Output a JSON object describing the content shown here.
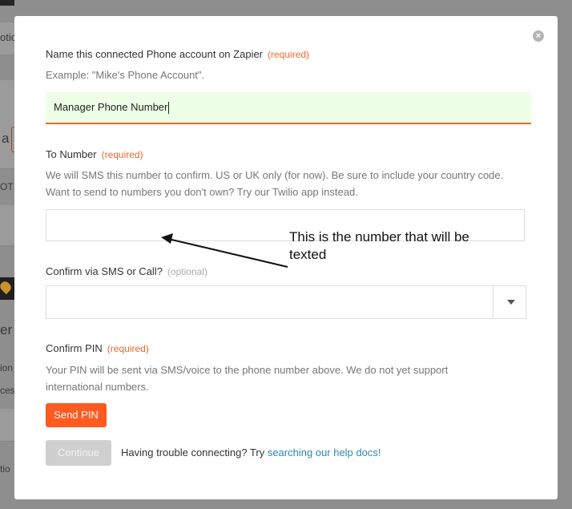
{
  "background": {
    "fragments": [
      "otic",
      "a",
      "OT",
      "er",
      "ion",
      "ces",
      "tio"
    ]
  },
  "modal": {
    "close_icon": "×",
    "account_name": {
      "label": "Name this connected Phone account on Zapier",
      "required": "(required)",
      "example": "Example: \"Mike's Phone Account\".",
      "value": "Manager Phone Number"
    },
    "to_number": {
      "label": "To Number",
      "required": "(required)",
      "help_line1": "We will SMS this number to confirm. US or UK only (for now). Be sure to include your country code.",
      "help_line2": "Want to send to numbers you don't own? Try our Twilio app instead.",
      "value": ""
    },
    "confirm_method": {
      "label": "Confirm via SMS or Call?",
      "optional": "(optional)",
      "selected": ""
    },
    "confirm_pin": {
      "label": "Confirm PIN",
      "required": "(required)",
      "help_line1": "Your PIN will be sent via SMS/voice to the phone number above. We do not yet support",
      "help_line2": "international numbers.",
      "send_button": "Send PIN"
    },
    "footer": {
      "continue_button": "Continue",
      "trouble_text": "Having trouble connecting? Try ",
      "help_link": "searching our help docs!"
    }
  },
  "annotation": {
    "text": "This is the number that will be texted"
  },
  "colors": {
    "accent": "#e86a2c",
    "button": "#ff5a1f",
    "link": "#2a88b0",
    "input_highlight": "#edffe7"
  }
}
